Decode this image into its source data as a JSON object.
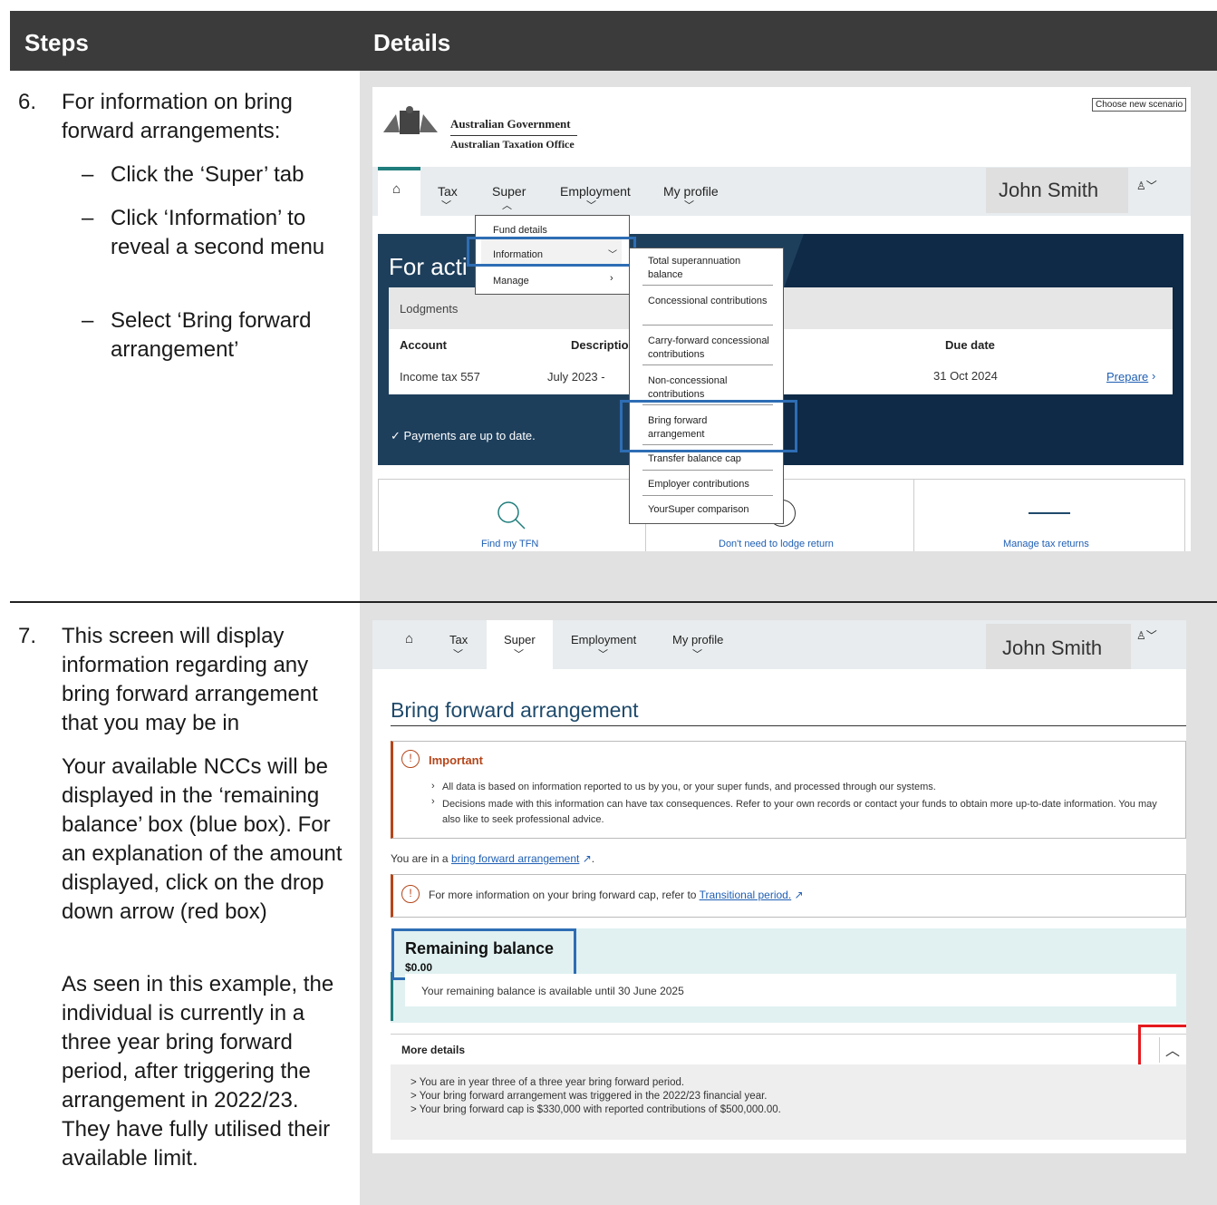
{
  "header": {
    "steps": "Steps",
    "details": "Details"
  },
  "step6": {
    "number": "6.",
    "text": "For information on bring forward arrangements:",
    "bullets": [
      "Click the ‘Super’ tab",
      "Click ‘Information’ to reveal a second menu",
      "Select ‘Bring forward arrangement’"
    ]
  },
  "step7": {
    "number": "7.",
    "paras": [
      "This screen will display information regarding any bring forward arrangement that you may be in",
      "Your available NCCs will be displayed in the ‘remaining balance’ box (blue box). For an explanation of the amount displayed, click on the drop down arrow (red box)",
      "As seen in this example, the individual is currently in a three year bring forward period, after triggering the arrangement in 2022/23. They have fully utilised their available limit."
    ]
  },
  "shot1": {
    "choose_btn": "Choose new scenario",
    "gov1": "Australian Government",
    "gov2": "Australian Taxation Office",
    "nav": [
      "Tax",
      "Super",
      "Employment",
      "My profile"
    ],
    "user": "John Smith",
    "menu1": [
      "Fund details",
      "Information",
      "Manage"
    ],
    "menu2": [
      "Total superannuation balance",
      "Concessional contributions",
      "Carry-forward concessional contributions",
      "Non-concessional contributions",
      "Bring forward arrangement",
      "Transfer balance cap",
      "Employer contributions",
      "YourSuper comparison"
    ],
    "banner": "For acti",
    "lodgments": "Lodgments",
    "cols": [
      "Account",
      "Descriptio",
      "Due date"
    ],
    "row": [
      "Income tax 557",
      "July 2023 -",
      "31 Oct 2024",
      "Prepare"
    ],
    "payments": "Payments are up to date.",
    "tiles": [
      "Find my TFN",
      "Don't need to lodge return",
      "Manage tax returns"
    ]
  },
  "shot2": {
    "nav": [
      "Tax",
      "Super",
      "Employment",
      "My profile"
    ],
    "user": "John Smith",
    "title": "Bring forward arrangement",
    "important": "Important",
    "imp_items": [
      "All data is based on information reported to us by you, or your super funds, and processed through our systems.",
      "Decisions made with this information can have tax consequences. Refer to your own records or contact your funds to obtain more up-to-date information. You may also like to seek professional advice."
    ],
    "in_prefix": "You are in a ",
    "in_link": "bring forward arrangement",
    "more_info": "For more information on your bring forward cap, refer to ",
    "more_link": "Transitional period.",
    "rb_title": "Remaining balance",
    "rb_amount": "$0.00",
    "rb_note": "Your remaining balance is available until 30 June 2025",
    "more_details": "More details",
    "details": [
      "> You are in year three of a three year bring forward period.",
      "> Your bring forward arrangement was triggered in the 2022/23 financial year.",
      "> Your bring forward cap is $330,000 with reported contributions of $500,000.00."
    ]
  }
}
